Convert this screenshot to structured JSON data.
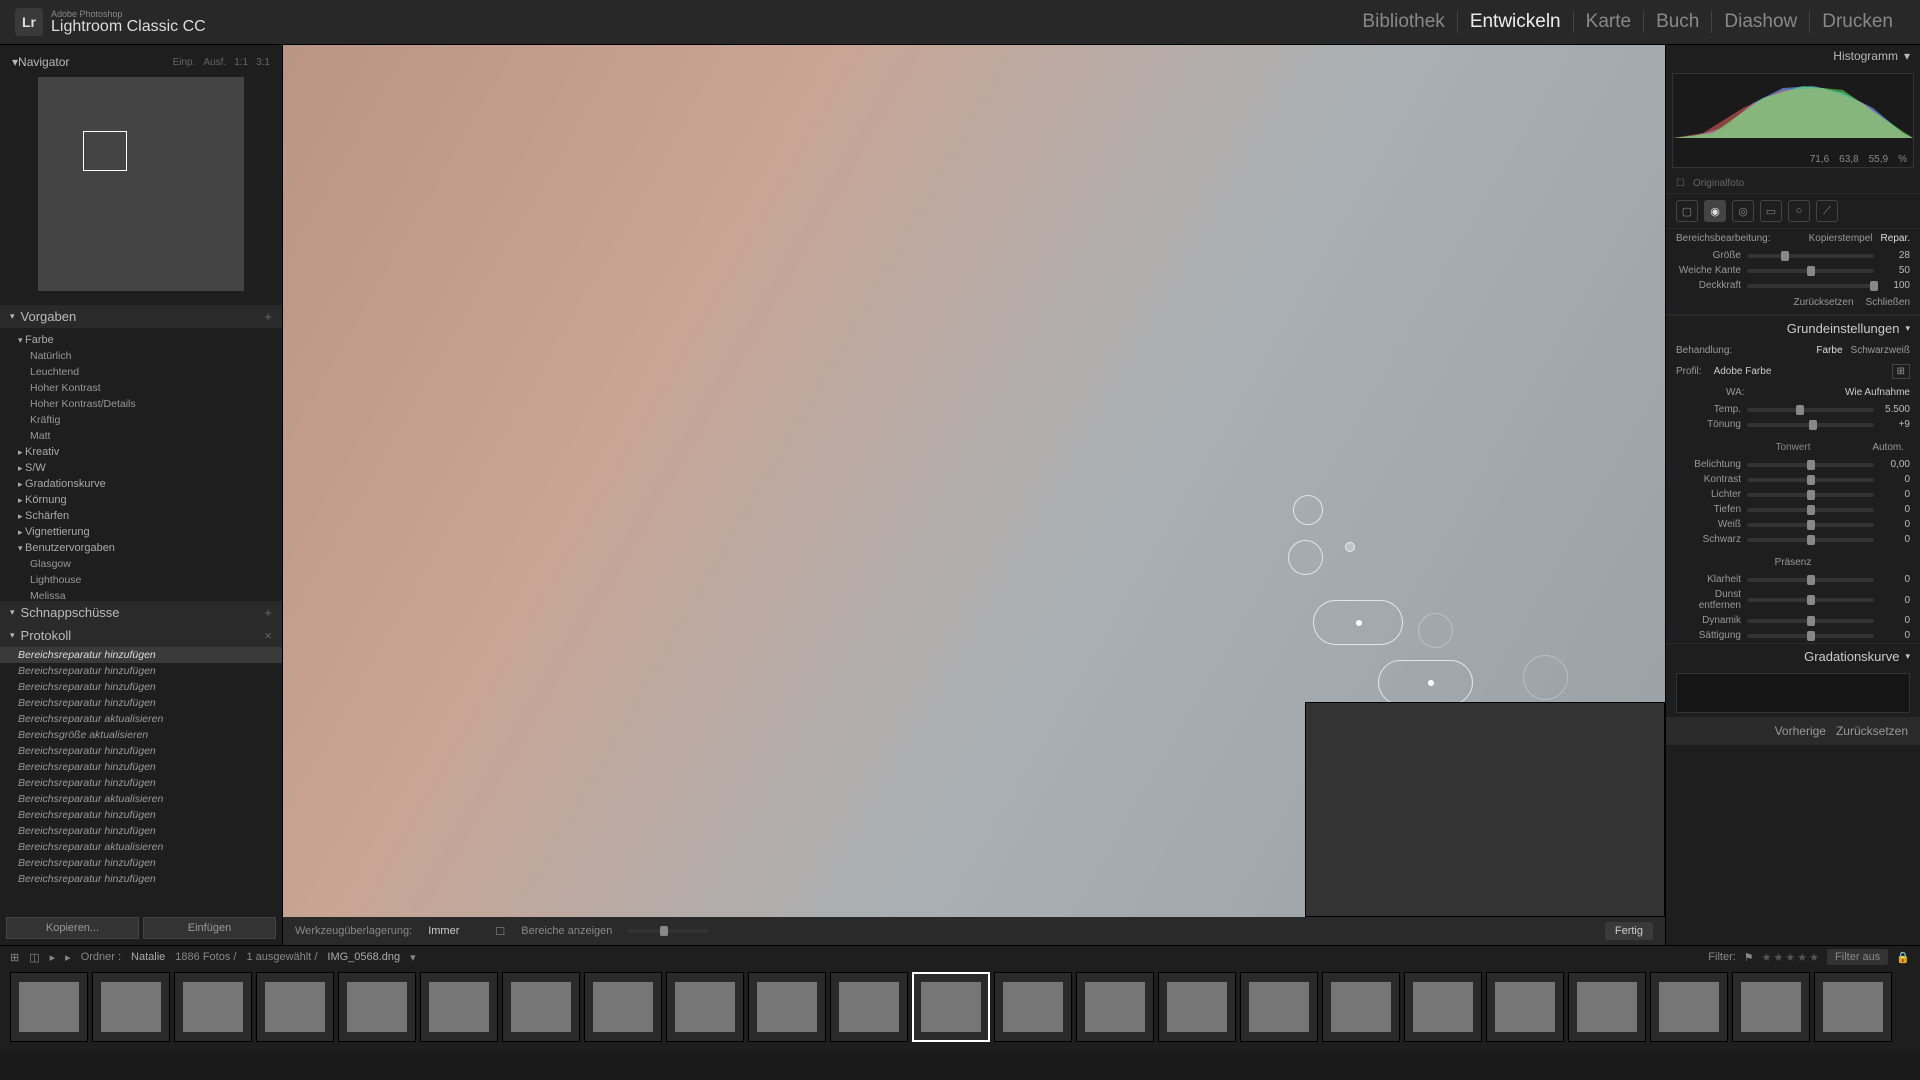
{
  "app": {
    "sub": "Adobe Photoshop",
    "main": "Lightroom Classic CC",
    "logo": "Lr"
  },
  "modules": [
    "Bibliothek",
    "Entwickeln",
    "Karte",
    "Buch",
    "Diashow",
    "Drucken"
  ],
  "active_module": 1,
  "navigator": {
    "title": "Navigator",
    "opts": [
      "Einp.",
      "Ausf.",
      "1:1",
      "3:1"
    ]
  },
  "presets_header": "Vorgaben",
  "snapshots_header": "Schnappschüsse",
  "history_header": "Protokoll",
  "preset_groups": [
    {
      "name": "Farbe",
      "open": true,
      "items": [
        "Natürlich",
        "Leuchtend",
        "Hoher Kontrast",
        "Hoher Kontrast/Details",
        "Kräftig",
        "Matt"
      ]
    },
    {
      "name": "Kreativ",
      "open": false
    },
    {
      "name": "S/W",
      "open": false
    },
    {
      "name": "Gradationskurve",
      "open": false
    },
    {
      "name": "Körnung",
      "open": false
    },
    {
      "name": "Schärfen",
      "open": false
    },
    {
      "name": "Vignettierung",
      "open": false
    },
    {
      "name": "Benutzervorgaben",
      "open": true,
      "items": [
        "Glasgow",
        "Lighthouse",
        "Melissa"
      ]
    }
  ],
  "history": [
    "Bereichsreparatur hinzufügen",
    "Bereichsreparatur hinzufügen",
    "Bereichsreparatur hinzufügen",
    "Bereichsreparatur hinzufügen",
    "Bereichsreparatur aktualisieren",
    "Bereichsgröße aktualisieren",
    "Bereichsreparatur hinzufügen",
    "Bereichsreparatur hinzufügen",
    "Bereichsreparatur hinzufügen",
    "Bereichsreparatur aktualisieren",
    "Bereichsreparatur hinzufügen",
    "Bereichsreparatur hinzufügen",
    "Bereichsreparatur aktualisieren",
    "Bereichsreparatur hinzufügen",
    "Bereichsreparatur hinzufügen"
  ],
  "copy_btn": "Kopieren...",
  "paste_btn": "Einfügen",
  "overlay_label": "Werkzeugüberlagerung:",
  "overlay_mode": "Immer",
  "show_areas": "Bereiche anzeigen",
  "done": "Fertig",
  "prev_btn": "Vorherige",
  "reset_btn": "Zurücksetzen",
  "histogram": {
    "title": "Histogramm",
    "vals": [
      "71,6",
      "63,8",
      "55,9"
    ],
    "pct": "%"
  },
  "original": "Originalfoto",
  "spot": {
    "label": "Bereichsbearbeitung:",
    "clone": "Kopierstempel",
    "heal": "Repar."
  },
  "spot_sliders": [
    {
      "lbl": "Größe",
      "val": "28",
      "pos": 30
    },
    {
      "lbl": "Weiche Kante",
      "val": "50",
      "pos": 50
    },
    {
      "lbl": "Deckkraft",
      "val": "100",
      "pos": 100
    }
  ],
  "reset_close": {
    "reset": "Zurücksetzen",
    "close": "Schließen"
  },
  "basic": {
    "hdr": "Grundeinstellungen",
    "treat": "Behandlung:",
    "color": "Farbe",
    "bw": "Schwarzweiß",
    "profile_lbl": "Profil:",
    "profile": "Adobe Farbe",
    "wb_lbl": "WA:",
    "wb": "Wie Aufnahme",
    "temp": "Temp.",
    "temp_val": "5.500",
    "tint": "Tönung",
    "tint_val": "+9",
    "tone": "Tonwert",
    "auto": "Autom.",
    "sliders": [
      {
        "lbl": "Belichtung",
        "val": "0,00",
        "pos": 50
      },
      {
        "lbl": "Kontrast",
        "val": "0",
        "pos": 50
      },
      {
        "lbl": "Lichter",
        "val": "0",
        "pos": 50
      },
      {
        "lbl": "Tiefen",
        "val": "0",
        "pos": 50
      },
      {
        "lbl": "Weiß",
        "val": "0",
        "pos": 50
      },
      {
        "lbl": "Schwarz",
        "val": "0",
        "pos": 50
      }
    ],
    "presence": "Präsenz",
    "psliders": [
      {
        "lbl": "Klarheit",
        "val": "0",
        "pos": 50
      },
      {
        "lbl": "Dunst entfernen",
        "val": "0",
        "pos": 50
      },
      {
        "lbl": "Dynamik",
        "val": "0",
        "pos": 50
      },
      {
        "lbl": "Sättigung",
        "val": "0",
        "pos": 50
      }
    ]
  },
  "tonecurve": "Gradationskurve",
  "film": {
    "folder": "Ordner :",
    "name": "Natalie",
    "count": "1886 Fotos /",
    "sel": "1 ausgewählt /",
    "file": "IMG_0568.dng",
    "filter": "Filter:",
    "filteroff": "Filter aus"
  }
}
